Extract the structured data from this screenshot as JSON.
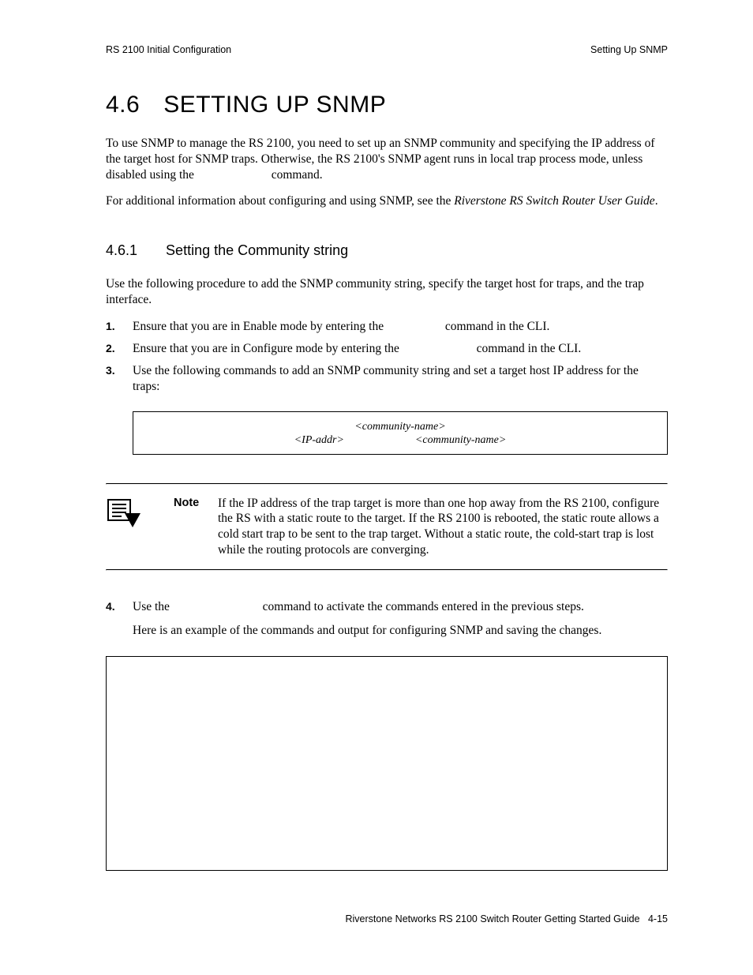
{
  "header": {
    "left": "RS 2100 Initial Configuration",
    "right": "Setting Up SNMP"
  },
  "section": {
    "number": "4.6",
    "title": "SETTING UP SNMP"
  },
  "intro": {
    "p1_a": "To use SNMP to manage the RS 2100, you need to set up an SNMP community and specifying the IP address of the target host for SNMP traps. Otherwise, the RS 2100's SNMP agent runs in local trap process mode, unless disabled using the ",
    "p1_gap": "                       ",
    "p1_b": " command.",
    "p2_a": "For additional information about configuring and using SNMP, see the ",
    "p2_ital": "Riverstone RS Switch Router User Guide",
    "p2_b": "."
  },
  "subsection": {
    "number": "4.6.1",
    "title": "Setting the Community string"
  },
  "sub_intro": "Use the following procedure to add the SNMP community string, specify the target host for traps, and the trap interface.",
  "steps": {
    "s1": {
      "marker": "1.",
      "a": "Ensure that you are in Enable mode by entering the ",
      "b": " command in the CLI."
    },
    "s2": {
      "marker": "2.",
      "a": "Ensure that you are in Configure mode by entering the ",
      "b": " command in the CLI."
    },
    "s3": {
      "marker": "3.",
      "text": "Use the following commands to add an SNMP community string and set a target host IP address for the traps:"
    },
    "s4": {
      "marker": "4.",
      "a": "Use the ",
      "b": " command to activate the commands entered in the previous steps.",
      "p2": "Here is an example of the commands and output for configuring SNMP and saving the changes."
    }
  },
  "cmdbox": {
    "line1_ital": "<community-name>",
    "line2_ital_a": "<IP-addr>",
    "line2_gap": "                    ",
    "line2_ital_b": "<community-name>"
  },
  "note": {
    "label": "Note",
    "body": "If the IP address of the trap target is more than one hop away from the RS 2100, configure the RS with a static route to the target. If the RS 2100 is rebooted, the static route allows a cold start trap to be sent to the trap target. Without a static route, the cold-start trap is lost while the routing protocols are converging."
  },
  "footer": {
    "text_a": "Riverstone Networks RS 2100 Switch Router Getting Started Guide",
    "text_b": "4-15"
  }
}
